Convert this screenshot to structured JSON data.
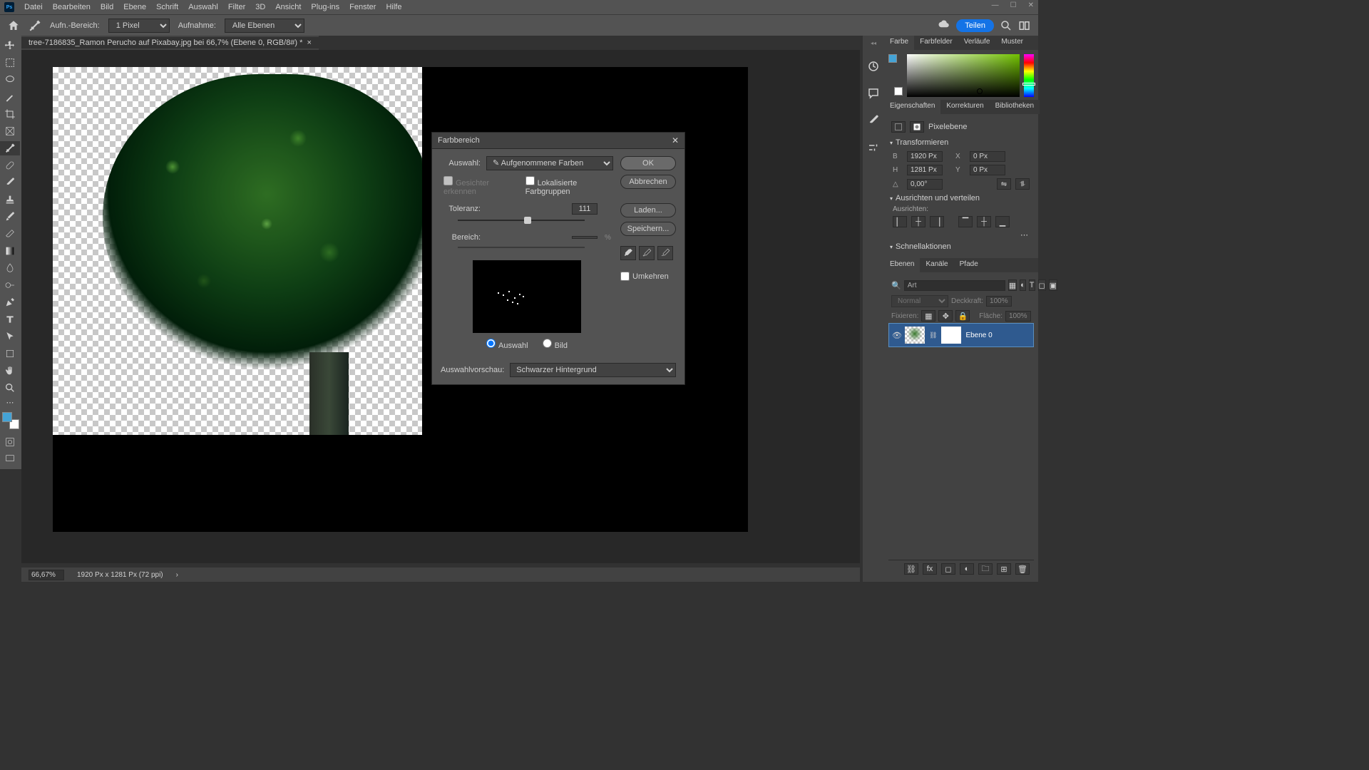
{
  "menu": [
    "Datei",
    "Bearbeiten",
    "Bild",
    "Ebene",
    "Schrift",
    "Auswahl",
    "Filter",
    "3D",
    "Ansicht",
    "Plug-ins",
    "Fenster",
    "Hilfe"
  ],
  "options": {
    "aufn_bereich_label": "Aufn.-Bereich:",
    "aufn_bereich_value": "1 Pixel",
    "aufnahme_label": "Aufnahme:",
    "aufnahme_value": "Alle Ebenen",
    "share": "Teilen"
  },
  "doc_tab": {
    "title": "tree-7186835_Ramon Perucho auf Pixabay.jpg bei 66,7% (Ebene 0, RGB/8#) *"
  },
  "dialog": {
    "title": "Farbbereich",
    "auswahl_label": "Auswahl:",
    "auswahl_value": "Aufgenommene Farben",
    "gesichter": "Gesichter erkennen",
    "lokal": "Lokalisierte Farbgruppen",
    "toleranz_label": "Toleranz:",
    "toleranz_value": "111",
    "bereich_label": "Bereich:",
    "bereich_value": "",
    "bereich_unit": "%",
    "radio_auswahl": "Auswahl",
    "radio_bild": "Bild",
    "vorschau_label": "Auswahlvorschau:",
    "vorschau_value": "Schwarzer Hintergrund",
    "ok": "OK",
    "abbrechen": "Abbrechen",
    "laden": "Laden...",
    "speichern": "Speichern...",
    "umkehren": "Umkehren"
  },
  "right_tabs": {
    "farbe": "Farbe",
    "farbfelder": "Farbfelder",
    "verlaufe": "Verläufe",
    "muster": "Muster",
    "eigenschaften": "Eigenschaften",
    "korrekturen": "Korrekturen",
    "bibliotheken": "Bibliotheken",
    "ebenen": "Ebenen",
    "kanale": "Kanäle",
    "pfade": "Pfade"
  },
  "props": {
    "pixelebene": "Pixelebene",
    "transformieren": "Transformieren",
    "B": "B",
    "B_v": "1920 Px",
    "X": "X",
    "X_v": "0 Px",
    "H": "H",
    "H_v": "1281 Px",
    "Y": "Y",
    "Y_v": "0 Px",
    "angle": "0,00°",
    "ausrichten_hdr": "Ausrichten und verteilen",
    "ausrichten_lbl": "Ausrichten:",
    "schnellaktionen": "Schnellaktionen"
  },
  "layers": {
    "filter_placeholder": "Art",
    "blend": "Normal",
    "deckkraft_label": "Deckkraft:",
    "deckkraft": "100%",
    "fixieren": "Fixieren:",
    "flaeche_label": "Fläche:",
    "flaeche": "100%",
    "layer_name": "Ebene 0"
  },
  "status": {
    "zoom": "66,67%",
    "dims": "1920 Px x 1281 Px (72 ppi)"
  }
}
